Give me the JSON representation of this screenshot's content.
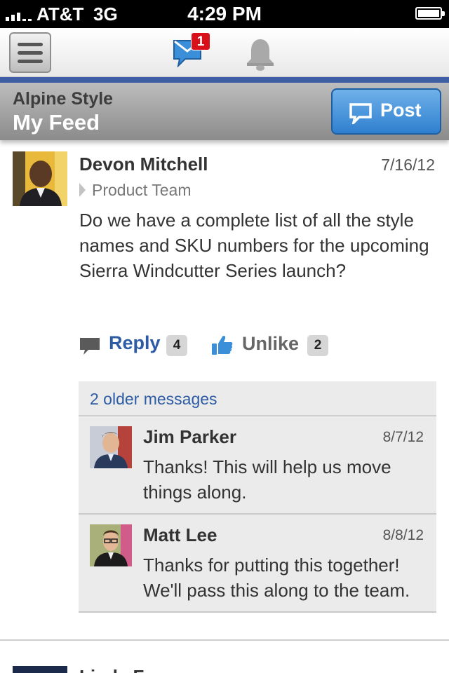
{
  "status_bar": {
    "carrier": "AT&T",
    "network": "3G",
    "time": "4:29 PM"
  },
  "top_nav": {
    "menu_icon": "hamburger-menu-icon",
    "mail_icon": "envelope-icon",
    "mail_badge": "1",
    "bell_icon": "bell-icon",
    "accent_color": "#3f5fa5"
  },
  "header": {
    "group": "Alpine Style",
    "title": "My Feed",
    "post_label": "Post",
    "post_icon": "speech-bubble-icon"
  },
  "post": {
    "author": "Devon Mitchell",
    "date": "7/16/12",
    "group": "Product Team",
    "body": "Do we have a complete list of all the style names and SKU numbers for the upcoming Sierra Windcutter Series launch?",
    "reply_label": "Reply",
    "reply_count": "4",
    "unlike_label": "Unlike",
    "like_count": "2"
  },
  "comments": {
    "older_label": "2 older messages",
    "items": [
      {
        "author": "Jim Parker",
        "date": "8/7/12",
        "text": "Thanks! This will help us move things along."
      },
      {
        "author": "Matt Lee",
        "date": "8/8/12",
        "text": "Thanks for putting this together! We'll pass this along to the team."
      }
    ]
  },
  "next_post": {
    "author": "Linda F",
    "date": ""
  }
}
